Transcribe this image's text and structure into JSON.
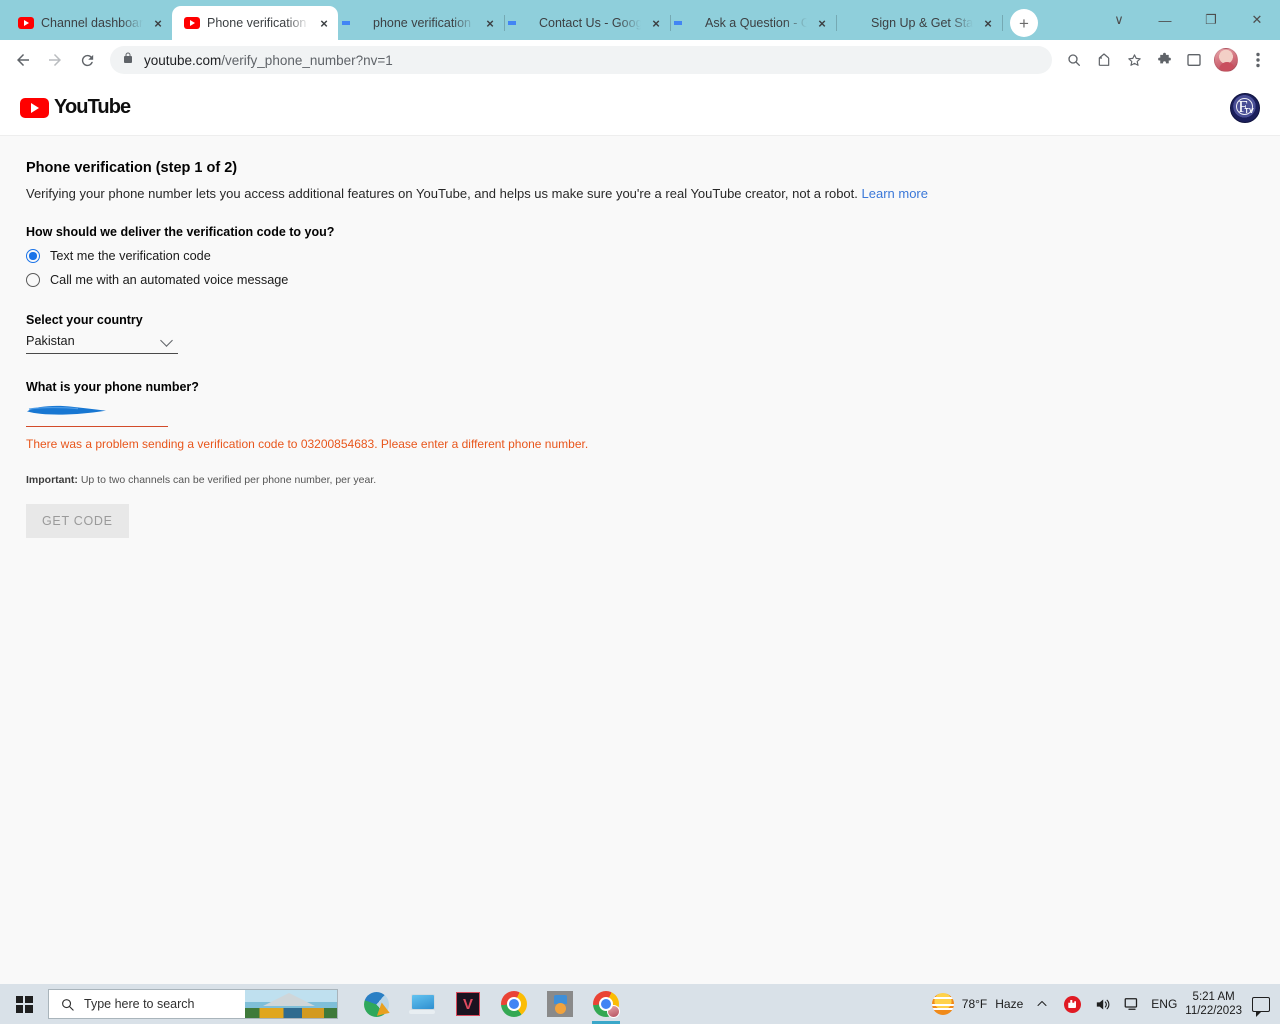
{
  "browser": {
    "tabs": [
      {
        "title": "Channel dashboard",
        "favicon": "youtube-icon",
        "active": false
      },
      {
        "title": "Phone verification",
        "favicon": "youtube-icon",
        "active": true
      },
      {
        "title": "phone verification",
        "favicon": "google-icon",
        "active": false
      },
      {
        "title": "Contact Us - Goog",
        "favicon": "google-icon",
        "active": false
      },
      {
        "title": "Ask a Question - G",
        "favicon": "google-icon",
        "active": false
      },
      {
        "title": "Sign Up & Get Star",
        "favicon": "quora-icon",
        "active": false
      }
    ],
    "tab_close_label": "×",
    "new_tab_label": "+",
    "window_controls": {
      "tab_search": "∨",
      "minimize": "—",
      "maximize": "❐",
      "close": "✕"
    },
    "toolbar": {
      "back": "←",
      "forward": "→",
      "reload": "⟳",
      "lock_icon": "lock-icon",
      "url_host": "youtube.com",
      "url_path": "/verify_phone_number?nv=1",
      "zoom_icon": "search-icon",
      "share_icon": "share-icon",
      "bookmark_icon": "star-icon",
      "extensions_icon": "puzzle-icon",
      "sidepanel_icon": "side-panel-icon",
      "profile_icon": "avatar",
      "menu_icon": "three-dot-menu-icon"
    }
  },
  "page": {
    "header": {
      "logo_text": "YouTube",
      "account_avatar_letter": "F",
      "account_avatar_sub": "TV"
    },
    "title": "Phone verification (step 1 of 2)",
    "description": "Verifying your phone number lets you access additional features on YouTube, and helps us make sure you're a real YouTube creator, not a robot.",
    "learn_more": "Learn more",
    "delivery_question": "How should we deliver the verification code to you?",
    "options": [
      {
        "label": "Text me the verification code",
        "selected": true
      },
      {
        "label": "Call me with an automated voice message",
        "selected": false
      }
    ],
    "country_label": "Select your country",
    "country_value": "Pakistan",
    "phone_label": "What is your phone number?",
    "phone_value": "",
    "phone_redacted": true,
    "error_message": "There was a problem sending a verification code to 03200854683. Please enter a different phone number.",
    "important_prefix": "Important:",
    "important_text": " Up to two channels can be verified per phone number, per year.",
    "submit_label": "GET CODE",
    "submit_disabled": true,
    "colors": {
      "accent_red": "#ff0000",
      "link_blue": "#3b78d8",
      "radio_blue": "#1a73e8",
      "error_orange": "#e8561c",
      "redaction_blue": "#1877d2"
    }
  },
  "taskbar": {
    "start_label": "start-button",
    "search_placeholder": "Type here to search",
    "apps": [
      {
        "name": "internet-download-manager",
        "active": false
      },
      {
        "name": "remote-desktop",
        "active": false
      },
      {
        "name": "valorant",
        "active": false
      },
      {
        "name": "google-chrome",
        "active": false
      },
      {
        "name": "media-app",
        "active": false
      },
      {
        "name": "google-chrome-window",
        "active": true
      }
    ],
    "tray": {
      "temperature": "78°F",
      "condition": "Haze",
      "show_hidden": "⌃",
      "language": "ENG",
      "time": "5:21 AM",
      "date": "11/22/2023"
    }
  }
}
